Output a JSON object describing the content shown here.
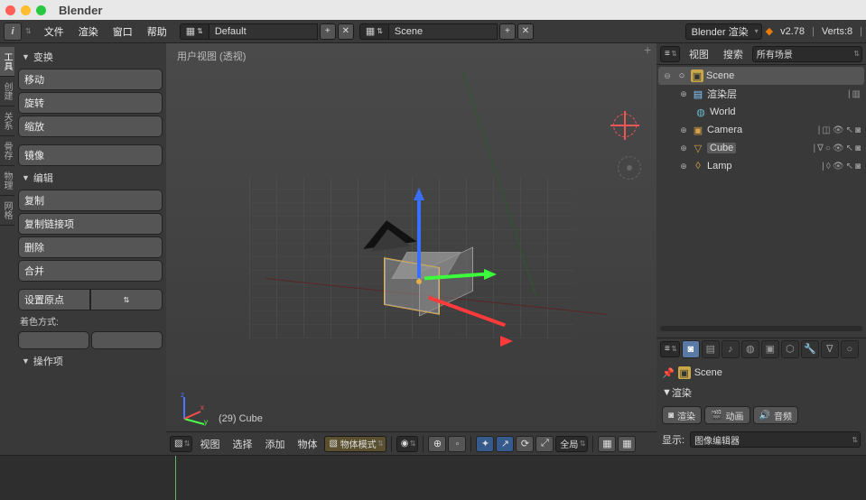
{
  "app": {
    "title": "Blender"
  },
  "topbar": {
    "menus": [
      "文件",
      "渲染",
      "窗口",
      "帮助"
    ],
    "layout_value": "Default",
    "scene_value": "Scene",
    "engine": "Blender 渲染",
    "version": "v2.78",
    "verts": "Verts:8"
  },
  "tool_tabs": [
    "工具",
    "创建",
    "关系",
    "骨存",
    "物理",
    "网格"
  ],
  "tool_panel": {
    "transform": {
      "title": "变换",
      "move": "移动",
      "rotate": "旋转",
      "scale": "缩放",
      "mirror": "镜像"
    },
    "edit": {
      "title": "编辑",
      "duplicate": "复制",
      "duplicate_linked": "复制链接项",
      "delete": "删除",
      "join": "合并",
      "set_origin": "设置原点",
      "shading_label": "着色方式:"
    },
    "history": {
      "title": "操作项"
    }
  },
  "viewport": {
    "label": "用户视图 (透视)",
    "object_label": "(29) Cube",
    "header_menus": [
      "视图",
      "选择",
      "添加",
      "物体"
    ],
    "mode": "物体模式",
    "orient": "全局"
  },
  "outliner": {
    "header_menus": [
      "视图",
      "搜索"
    ],
    "filter": "所有场景",
    "scene": "Scene",
    "render_layers": "渲染层",
    "world": "World",
    "camera": "Camera",
    "cube": "Cube",
    "lamp": "Lamp"
  },
  "properties": {
    "context_label": "Scene",
    "render_section": "渲染",
    "render_btn": "渲染",
    "anim_btn": "动画",
    "audio_btn": "音频",
    "display_label": "显示:",
    "display_value": "图像编辑器"
  }
}
